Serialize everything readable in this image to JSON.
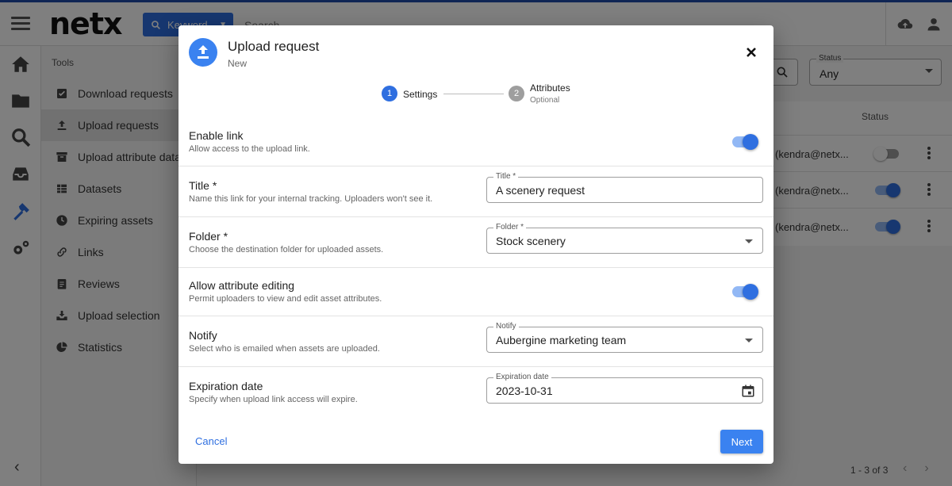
{
  "colors": {
    "accent": "#2f6fe0",
    "accent_light": "#92b8f5",
    "brand_stripe": "#1f4aa8"
  },
  "app": {
    "logo": "netx",
    "search": {
      "scope_label": "Keyword",
      "placeholder": "Search"
    },
    "tools_heading": "Tools",
    "tools": [
      {
        "label": "Download requests",
        "icon": "checkbox-icon"
      },
      {
        "label": "Upload requests",
        "icon": "upload-icon",
        "active": true
      },
      {
        "label": "Upload attribute data",
        "icon": "archive-icon"
      },
      {
        "label": "Datasets",
        "icon": "table-icon"
      },
      {
        "label": "Expiring assets",
        "icon": "clock-icon"
      },
      {
        "label": "Links",
        "icon": "link-icon"
      },
      {
        "label": "Reviews",
        "icon": "clipboard-icon"
      },
      {
        "label": "Upload selection",
        "icon": "download-tray-icon"
      },
      {
        "label": "Statistics",
        "icon": "pie-chart-icon"
      }
    ],
    "status_filter": {
      "label": "Status",
      "value": "Any"
    },
    "table": {
      "status_header": "Status",
      "rows": [
        {
          "email": "(kendra@netx...",
          "enabled": false
        },
        {
          "email": "(kendra@netx...",
          "enabled": true
        },
        {
          "email": "(kendra@netx...",
          "enabled": true
        }
      ]
    },
    "pagination": "1 - 3 of 3"
  },
  "dialog": {
    "title": "Upload request",
    "subtitle": "New",
    "steps": [
      {
        "number": "1",
        "label": "Settings",
        "active": true
      },
      {
        "number": "2",
        "label": "Attributes",
        "optional": "Optional",
        "active": false
      }
    ],
    "enable_link": {
      "title": "Enable link",
      "desc": "Allow access to the upload link.",
      "on": true
    },
    "title_field": {
      "title": "Title *",
      "desc": "Name this link for your internal tracking. Uploaders won't see it.",
      "label": "Title *",
      "value": "A scenery request"
    },
    "folder_field": {
      "title": "Folder *",
      "desc": "Choose the destination folder for uploaded assets.",
      "label": "Folder *",
      "value": "Stock scenery"
    },
    "attr_editing": {
      "title": "Allow attribute editing",
      "desc": "Permit uploaders to view and edit asset attributes.",
      "on": true
    },
    "notify_field": {
      "title": "Notify",
      "desc": "Select who is emailed when assets are uploaded.",
      "label": "Notify",
      "value": "Aubergine marketing team"
    },
    "expiration_field": {
      "title": "Expiration date",
      "desc": "Specify when upload link access will expire.",
      "label": "Expiration date",
      "value": "2023-10-31"
    },
    "cancel_label": "Cancel",
    "next_label": "Next"
  }
}
